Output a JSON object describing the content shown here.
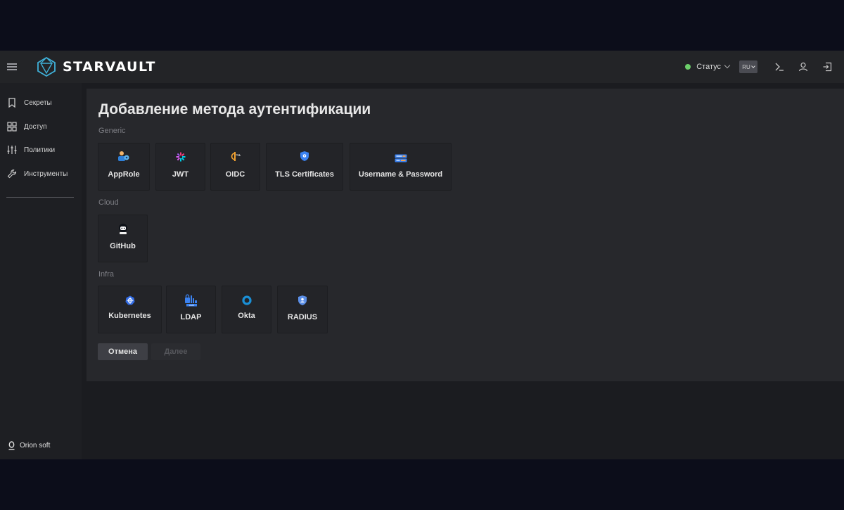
{
  "app": {
    "brand_name": "STARVAULT",
    "footer_brand": "Orion soft"
  },
  "header": {
    "status_label": "Статус",
    "status_color": "#6ccf6a",
    "lang_code": "RU",
    "icons": [
      "menu-icon",
      "terminal-icon",
      "user-icon",
      "logout-icon"
    ]
  },
  "sidebar": {
    "items": [
      {
        "label": "Секреты",
        "icon": "bookmark-icon"
      },
      {
        "label": "Доступ",
        "icon": "grid-icon"
      },
      {
        "label": "Политики",
        "icon": "sliders-icon"
      },
      {
        "label": "Инструменты",
        "icon": "wrench-icon"
      }
    ]
  },
  "main": {
    "title": "Добавление метода аутентификации",
    "sections": [
      {
        "label": "Generic",
        "methods": [
          {
            "label": "AppRole",
            "icon": "approle-icon"
          },
          {
            "label": "JWT",
            "icon": "jwt-icon"
          },
          {
            "label": "OIDC",
            "icon": "oidc-icon"
          },
          {
            "label": "TLS Certificates",
            "icon": "tls-shield-icon"
          },
          {
            "label": "Username & Password",
            "icon": "userpass-icon"
          }
        ]
      },
      {
        "label": "Cloud",
        "methods": [
          {
            "label": "GitHub",
            "icon": "github-icon"
          }
        ]
      },
      {
        "label": "Infra",
        "methods": [
          {
            "label": "Kubernetes",
            "icon": "kubernetes-icon"
          },
          {
            "label": "LDAP",
            "icon": "ldap-icon"
          },
          {
            "label": "Okta",
            "icon": "okta-icon"
          },
          {
            "label": "RADIUS",
            "icon": "radius-icon"
          }
        ]
      }
    ],
    "buttons": {
      "cancel": "Отмена",
      "next": "Далее"
    }
  },
  "colors": {
    "accent": "#4aa3df",
    "background": "#1b1c20",
    "panel": "#27282c"
  }
}
